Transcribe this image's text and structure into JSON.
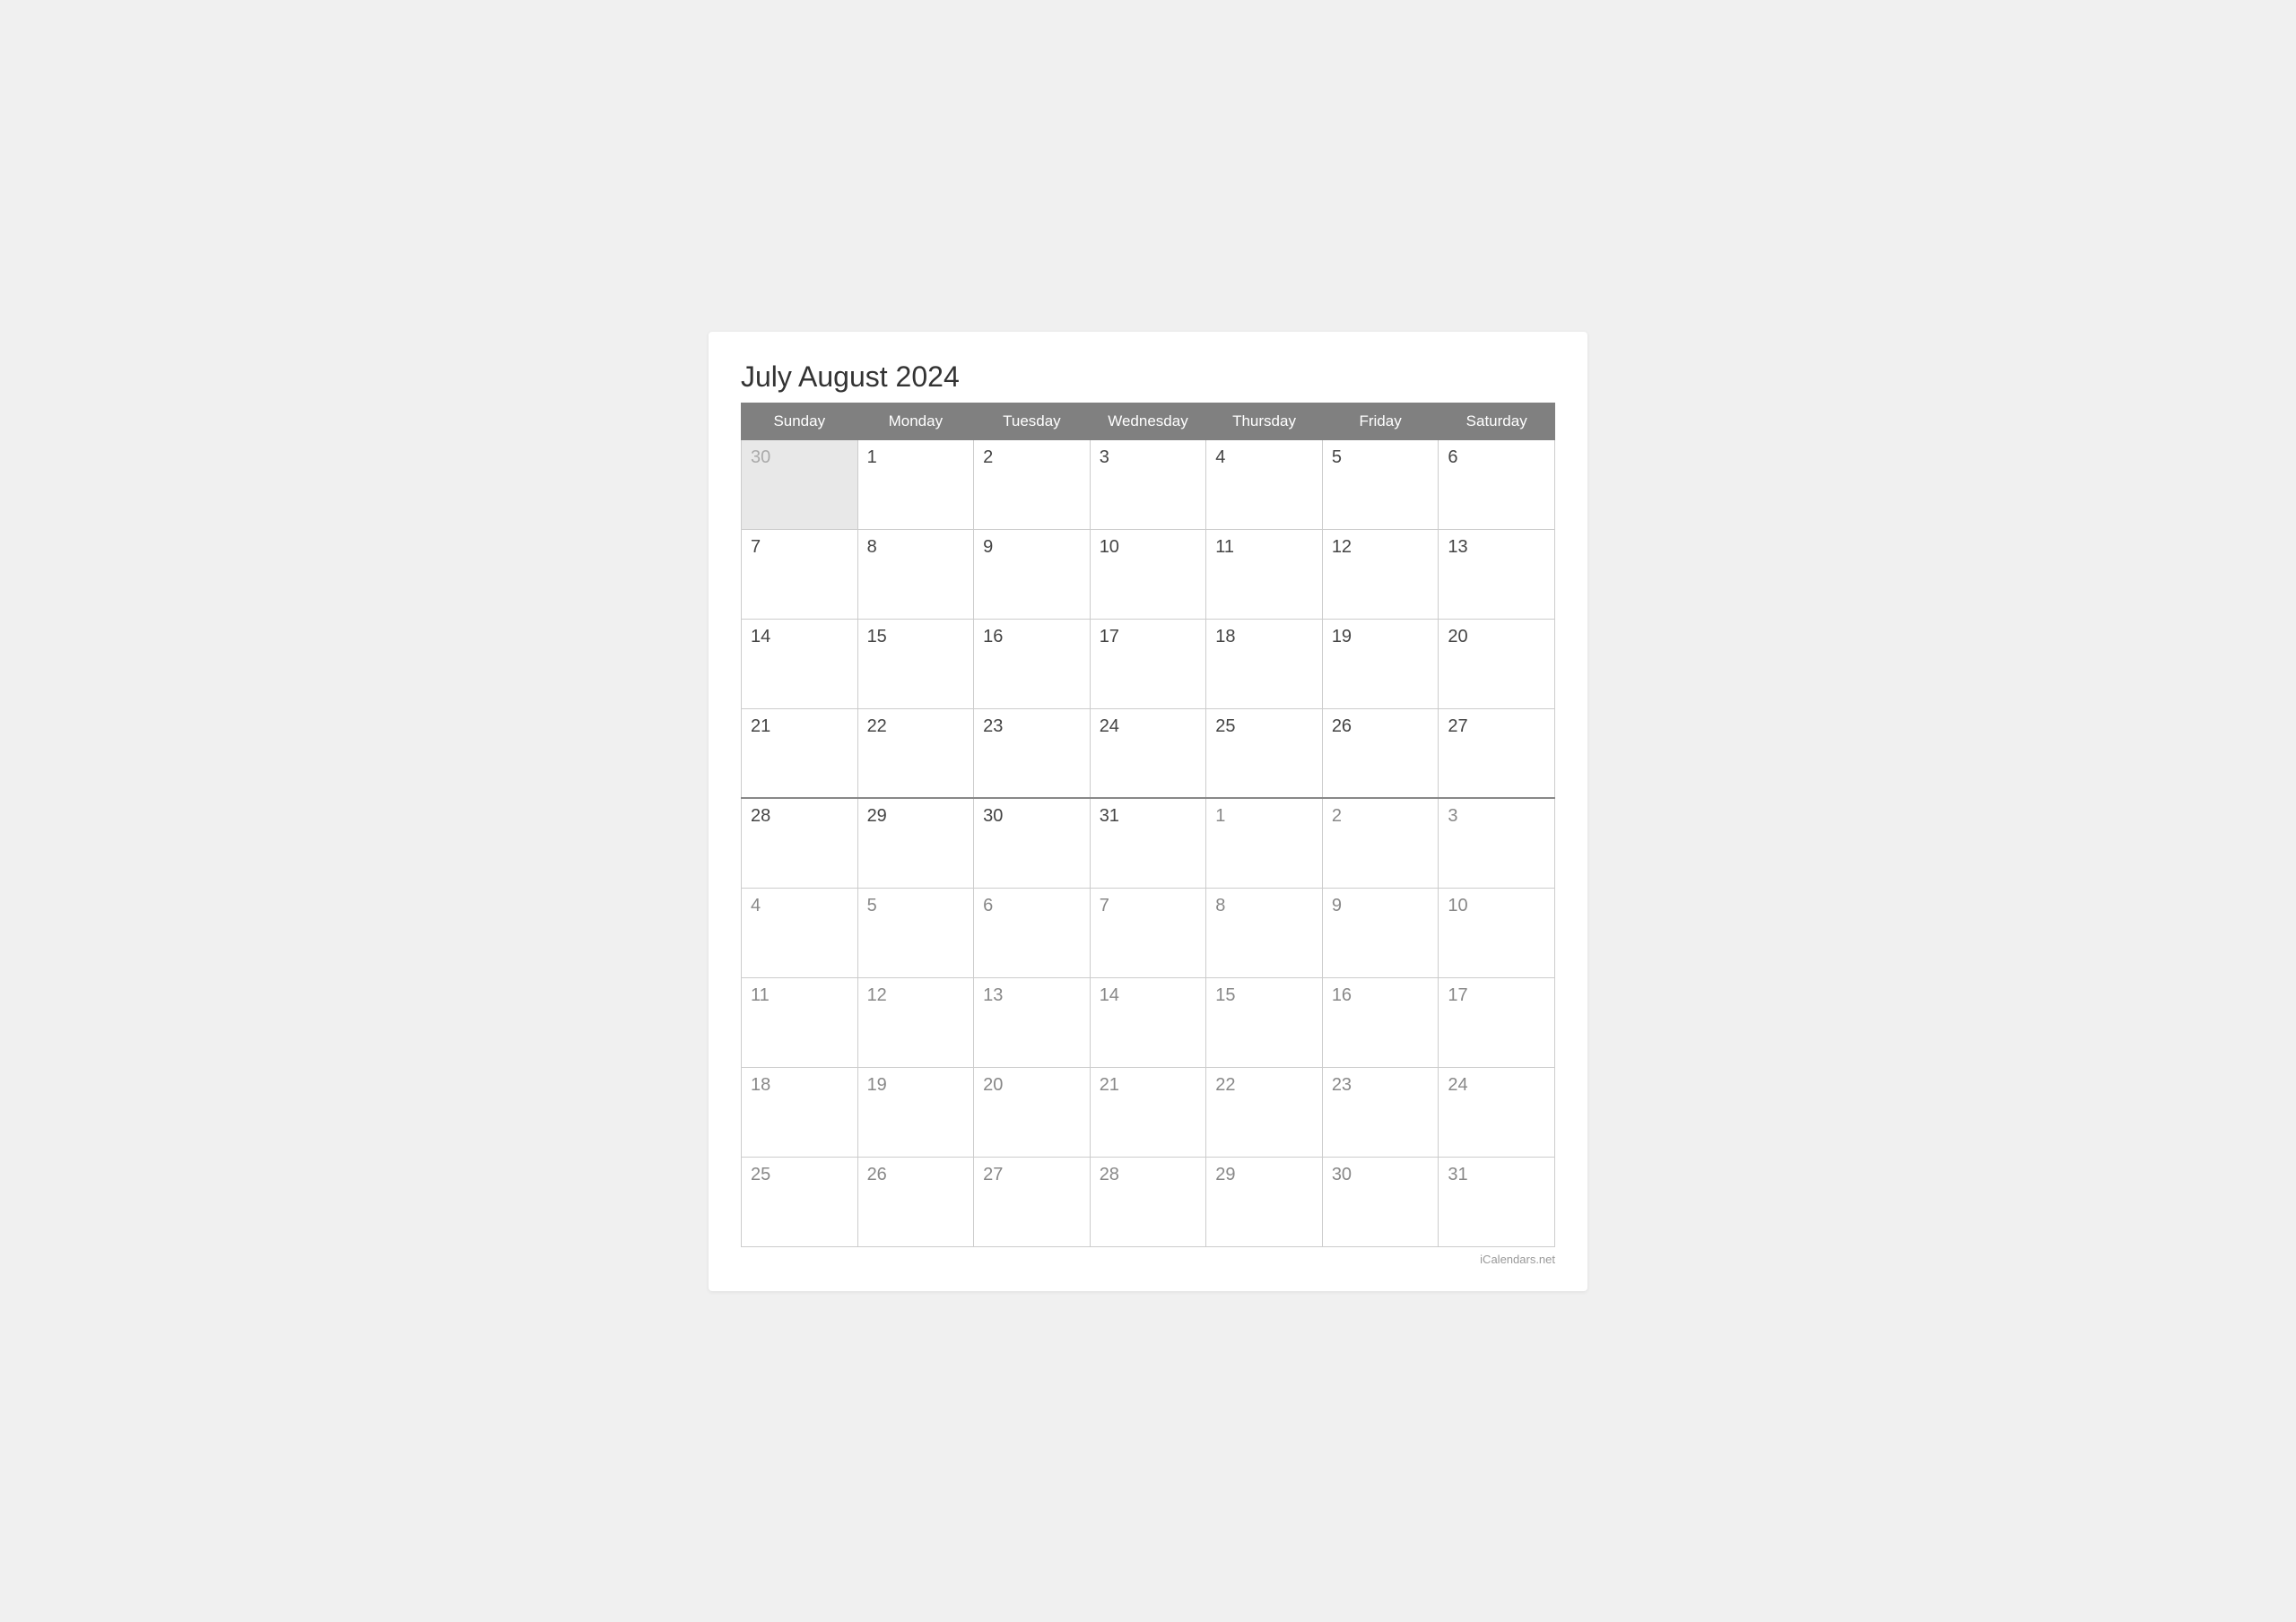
{
  "title": "July August 2024",
  "days_of_week": [
    "Sunday",
    "Monday",
    "Tuesday",
    "Wednesday",
    "Thursday",
    "Friday",
    "Saturday"
  ],
  "weeks": [
    [
      {
        "day": "30",
        "type": "prev-month"
      },
      {
        "day": "1",
        "type": "current"
      },
      {
        "day": "2",
        "type": "current"
      },
      {
        "day": "3",
        "type": "current"
      },
      {
        "day": "4",
        "type": "current"
      },
      {
        "day": "5",
        "type": "current"
      },
      {
        "day": "6",
        "type": "current"
      }
    ],
    [
      {
        "day": "7",
        "type": "current"
      },
      {
        "day": "8",
        "type": "current"
      },
      {
        "day": "9",
        "type": "current"
      },
      {
        "day": "10",
        "type": "current"
      },
      {
        "day": "11",
        "type": "current"
      },
      {
        "day": "12",
        "type": "current"
      },
      {
        "day": "13",
        "type": "current"
      }
    ],
    [
      {
        "day": "14",
        "type": "current"
      },
      {
        "day": "15",
        "type": "current"
      },
      {
        "day": "16",
        "type": "current"
      },
      {
        "day": "17",
        "type": "current"
      },
      {
        "day": "18",
        "type": "current"
      },
      {
        "day": "19",
        "type": "current"
      },
      {
        "day": "20",
        "type": "current"
      }
    ],
    [
      {
        "day": "21",
        "type": "current"
      },
      {
        "day": "22",
        "type": "current"
      },
      {
        "day": "23",
        "type": "current"
      },
      {
        "day": "24",
        "type": "current"
      },
      {
        "day": "25",
        "type": "current"
      },
      {
        "day": "26",
        "type": "current"
      },
      {
        "day": "27",
        "type": "current"
      }
    ],
    [
      {
        "day": "28",
        "type": "current"
      },
      {
        "day": "29",
        "type": "current"
      },
      {
        "day": "30",
        "type": "current"
      },
      {
        "day": "31",
        "type": "current"
      },
      {
        "day": "1",
        "type": "next-month-divider"
      },
      {
        "day": "2",
        "type": "next-month-divider"
      },
      {
        "day": "3",
        "type": "next-month-divider"
      }
    ],
    [
      {
        "day": "4",
        "type": "next-month"
      },
      {
        "day": "5",
        "type": "next-month"
      },
      {
        "day": "6",
        "type": "next-month"
      },
      {
        "day": "7",
        "type": "next-month"
      },
      {
        "day": "8",
        "type": "next-month"
      },
      {
        "day": "9",
        "type": "next-month"
      },
      {
        "day": "10",
        "type": "next-month"
      }
    ],
    [
      {
        "day": "11",
        "type": "next-month"
      },
      {
        "day": "12",
        "type": "next-month"
      },
      {
        "day": "13",
        "type": "next-month"
      },
      {
        "day": "14",
        "type": "next-month"
      },
      {
        "day": "15",
        "type": "next-month"
      },
      {
        "day": "16",
        "type": "next-month"
      },
      {
        "day": "17",
        "type": "next-month"
      }
    ],
    [
      {
        "day": "18",
        "type": "next-month"
      },
      {
        "day": "19",
        "type": "next-month"
      },
      {
        "day": "20",
        "type": "next-month"
      },
      {
        "day": "21",
        "type": "next-month"
      },
      {
        "day": "22",
        "type": "next-month"
      },
      {
        "day": "23",
        "type": "next-month"
      },
      {
        "day": "24",
        "type": "next-month"
      }
    ],
    [
      {
        "day": "25",
        "type": "next-month"
      },
      {
        "day": "26",
        "type": "next-month"
      },
      {
        "day": "27",
        "type": "next-month"
      },
      {
        "day": "28",
        "type": "next-month"
      },
      {
        "day": "29",
        "type": "next-month"
      },
      {
        "day": "30",
        "type": "next-month"
      },
      {
        "day": "31",
        "type": "next-month"
      }
    ]
  ],
  "footer": "iCalendars.net"
}
